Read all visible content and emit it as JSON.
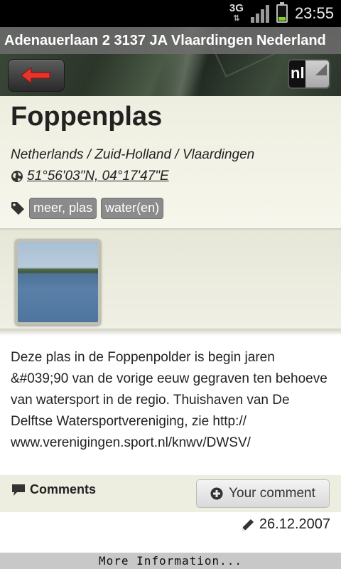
{
  "status_bar": {
    "network": "3G",
    "time": "23:55"
  },
  "header": {
    "address": "Adenauerlaan 2 3137 JA Vlaardingen Nederland",
    "language": "nl"
  },
  "place": {
    "title": "Foppenplas",
    "breadcrumb": "Netherlands / Zuid-Holland / Vlaardingen",
    "coordinates": "51°56'03\"N, 04°17'47\"E",
    "tags": [
      "meer, plas",
      "water(en)"
    ]
  },
  "description": "Deze plas in de Foppenpolder is begin jaren &#039;90 van de vorige eeuw gegraven ten behoeve van watersport in de regio. Thuishaven van De Delftse Watersportvereniging, zie http:// www.verenigingen.sport.nl/knwv/DWSV/",
  "comments": {
    "label": "Comments",
    "button_label": "Your comment"
  },
  "date": "26.12.2007",
  "footer": {
    "more_info": "More Information..."
  },
  "colors": {
    "back_arrow": "#e8332a",
    "tag_bg": "#8b8b8b",
    "panel_bg": "#eeeee0",
    "battery": "#7ed321"
  }
}
